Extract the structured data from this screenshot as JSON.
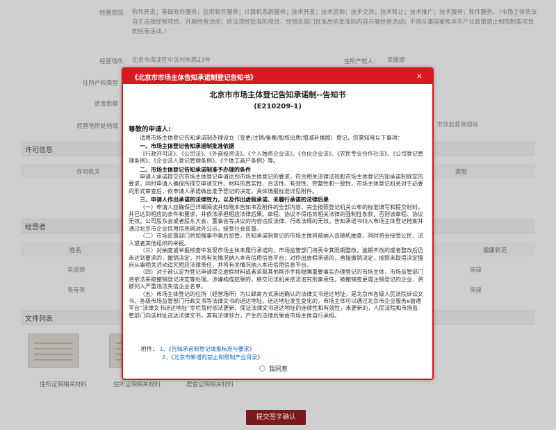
{
  "form": {
    "scope_label": "经营范围:",
    "scope_text": "软件开发；基础软件服务；应用软件服务；计算机系统服务；技术开发；技术咨询；技术交流；技术转让；技术推广；技术服务；软件服务。（市场主体依法自主选择经营项目，开展经营活动；依法须经批准的项目，经相关部门批准后依批准的内容开展经营活动；不得从事国家和本市产业政策禁止和限制类项目的经营活动。）",
    "address_label": "经营场所:",
    "address_value": "北京市海淀区中关村东路23号",
    "owner_label": "住所产权人:",
    "owner_value": "吴媛娜",
    "property_type_label": "住所产权类型",
    "capital_label": "资金数额",
    "region_label": "经营地所处地域",
    "region_value_partial": "海淀区市场监督管理局",
    "license_section": "许可信息",
    "license_col1": "许可机关",
    "license_col2": "类型",
    "operator_section": "经营者",
    "operator_cols": [
      "姓名",
      "健康状况"
    ],
    "operators": [
      {
        "name": "吴媛娜",
        "health": "健康"
      },
      {
        "name": "张春英",
        "health": "健康"
      }
    ],
    "files_section": "文件列表",
    "files": [
      "住所证明相关材料",
      "住所证明相关材料",
      "居住证明相关材料"
    ],
    "submit_label": "提交签字确认"
  },
  "modal": {
    "header_title": "《北京市市场主体告知承诺制登记告知书》",
    "close_label": "×",
    "doc_title": "北京市市场主体登记告知承诺制--告知书",
    "doc_code": "(E210209-1)",
    "greeting": "尊敬的申请人:",
    "intro": "适用市场主体登记告知承诺制办理设立（变更/注销/备案/股权出质/增减补换照）登记，您需知晓以下事项：",
    "s1_title": "一、市场主体登记告知承诺制批准依据",
    "s1_text": "《行政许可法》、《公司法》、《外商投资法》、《个人独资企业法》、《合伙企业法》、《农民专业合作社法》、《公司登记管理条例》、《企业法人登记管理条例》、《个体工商户条例》等。",
    "s2_title": "二、市场主体登记告知承诺制准予办理的条件",
    "s2_text": "申请人承诺提交的市场主体登记申请达到市场主体登记的要求，符合相关法律法规和市场主体登记告知承诺制规定的要求，同时申请人确保所提交申请文件、材料的真实性、合法性、有效性、完整性和一致性，市场主体登记机关对于必要的形式审查后，依申请人承诺做出准予登记的决定，具体填报标准详见附件。",
    "s3_title": "三、申请人作出承诺的法律效力，以及作出虚假承诺、未履行承诺的法律后果",
    "s3_p1": "（一）申请人应确保已详细阅读并知晓本告知书及附件的全部内容，完全按照登记机关公布的标准填写和提交材料，并已达到相应的条件和要求，并依法承担相应法律后果。章程、协议不得违背相关法律的强制性条款，否则该章程、协议无效。公司股东会或者股东大会、董事会等决议的内容违反法律、行政法规的无效。告知承诺书归入市场主体登记档案并通过北京市企业信用信息网对外公示，接受社会监督。",
    "s3_p2": "（二）市场监督部门将加强事中事后监管，告知承诺制登记的市场主体将被纳入双随机抽查，同时将会接受公民、法人或者其他组织的举报。",
    "s3_p3": "（三）对抽查或举报核查中发现市场主体未履行承诺的，市场监管部门将责令其限期整改，逾期不改的或者整改后仍未达到要求的，撤销决定，并将有关情况纳入本市信用信息平台；对作出虚假承诺的，直接撤销决定，按照未取得决定擅自从事相关活动追究相应法律责任，并将有关情况纳入本市信用信息平台。",
    "s3_p4": "（四）对于被认定为登记申请提交虚假材料或者采取其他欺诈手段隐瞒重要事实办理登记的市场主体，市场监管部门将依法采取撤销登记决定等处理。涉嫌构成犯罪的，移交司法机关依法追究刑事责任。被撤销变更或注销登记的企业，将被列入严重违法失信企业名单。",
    "s3_p5": "（五）市场主体登记的住所（经营场所）为以邮寄方式承诺确认的法律文书送达地址，是北京市各级人民法院诉讼文书、各级市场监管部门行政文书等法律文书的送达地址。送达地址发生变化的，市场主体可以通过北京市企业服务e窗通平台“法律文书送达地址”专栏及时依法更新，保证法律文书送达地址的连续性和有效性，未更新的，人民法院和市场监管部门向该地址送达法律文书，其有法律效力，产生的法律后果由市场主体自行承担。",
    "attach_prefix": "附件：",
    "attachments": [
      "1、《告知承诺制登记填报标准与要求》",
      "2、《北京市新增的禁止和限制产业目录》"
    ],
    "agree_label": "我同意"
  },
  "colors": {
    "modal_accent": "#d7191d",
    "link": "#1565c0",
    "overlay": "#cfcfcf",
    "submit": "#7a1a1a"
  }
}
